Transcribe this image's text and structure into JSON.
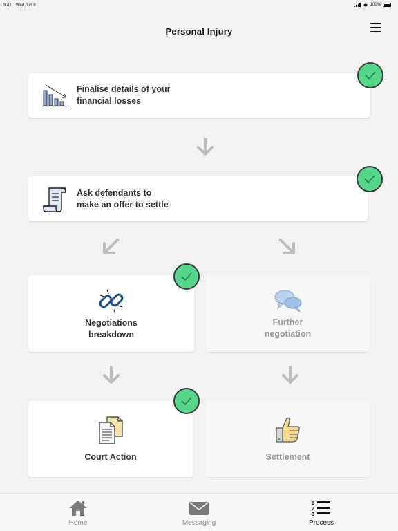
{
  "status_bar": {
    "time": "9:41",
    "date": "Wed Jun 8",
    "battery": "100%"
  },
  "header": {
    "title": "Personal Injury"
  },
  "steps": {
    "financial_losses": {
      "label_line1": "Finalise details of your",
      "label_line2": "financial losses",
      "completed": true,
      "icon": "chart-down-icon"
    },
    "ask_defendants": {
      "label_line1": "Ask defendants to",
      "label_line2": "make an offer to settle",
      "completed": true,
      "icon": "scroll-document-icon"
    },
    "negotiations_breakdown": {
      "label_line1": "Negotiations",
      "label_line2": "breakdown",
      "completed": true,
      "icon": "broken-chain-icon"
    },
    "further_negotiation": {
      "label_line1": "Further",
      "label_line2": "negotiation",
      "completed": false,
      "icon": "speech-bubbles-icon"
    },
    "court_action": {
      "label": "Court Action",
      "completed": true,
      "icon": "documents-icon"
    },
    "settlement": {
      "label": "Settlement",
      "completed": false,
      "icon": "thumbs-up-icon"
    }
  },
  "tabbar": {
    "home": {
      "label": "Home",
      "icon": "home-icon"
    },
    "messaging": {
      "label": "Messaging",
      "icon": "envelope-icon"
    },
    "process": {
      "label": "Process",
      "icon": "numbered-list-icon",
      "active": true
    }
  },
  "colors": {
    "check": "#55d68b",
    "background": "#f2f2f2",
    "arrow": "#bdbdbd",
    "muted_text": "#999999"
  }
}
